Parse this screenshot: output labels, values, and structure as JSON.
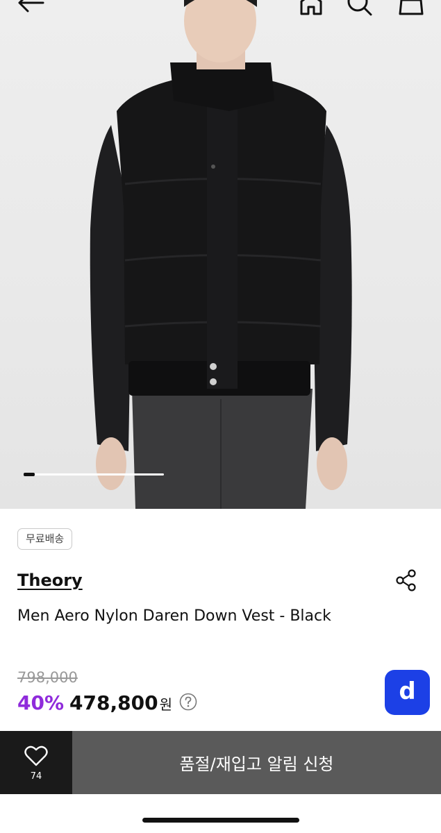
{
  "hero": {
    "image_desc": "product-photo-vest",
    "pager": {
      "current": 1,
      "total": 12
    }
  },
  "topbar": {
    "icons": [
      "back-arrow-icon",
      "home-icon",
      "search-icon",
      "shopping-bag-icon"
    ]
  },
  "product": {
    "badge": "무료배송",
    "brand": "Theory",
    "title": "Men Aero Nylon Daren Down Vest - Black",
    "original_price": "798,000",
    "discount": "40%",
    "price": "478,800",
    "currency": "원"
  },
  "fab": {
    "label": "d",
    "color": "#1c40e6"
  },
  "bottombar": {
    "like_count": "74",
    "cta_label": "품절/재입고 알림 신청"
  },
  "colors": {
    "accent_purple": "#8f2bdb",
    "cta_bg": "#5a5a5a",
    "like_bg": "#1a1a1a"
  }
}
